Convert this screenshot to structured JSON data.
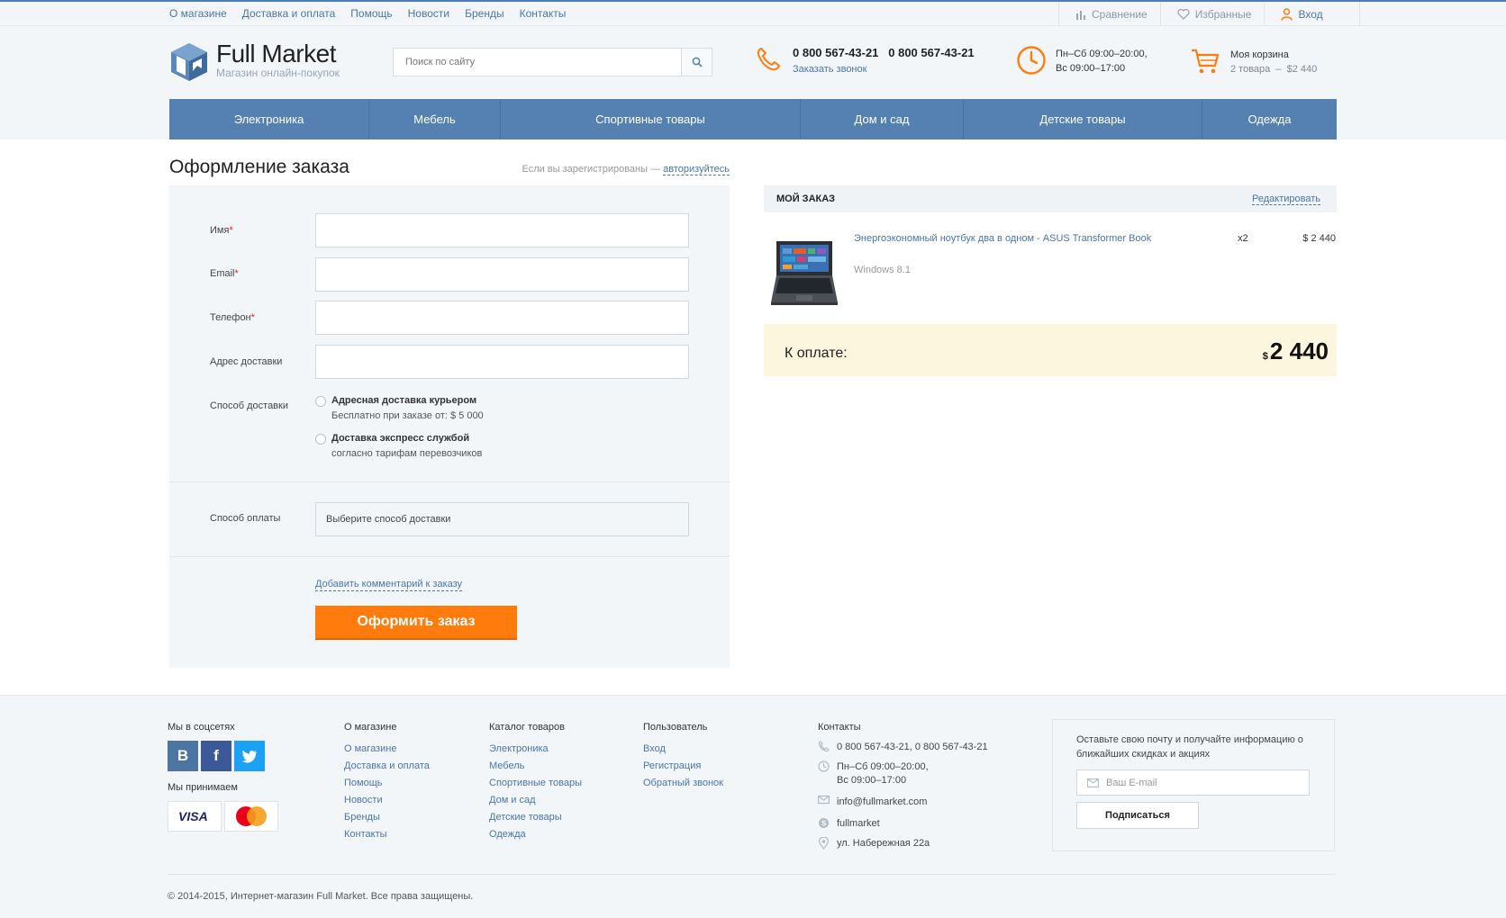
{
  "topnav": [
    "О магазине",
    "Доставка и оплата",
    "Помощь",
    "Новости",
    "Бренды",
    "Контакты"
  ],
  "topright": {
    "compare": "Сравнение",
    "favorites": "Избранные",
    "login": "Вход"
  },
  "logo": {
    "name": "Full Market",
    "tagline": "Магазин онлайн-покупок"
  },
  "search": {
    "placeholder": "Поиск по сайту"
  },
  "phone": {
    "numbers": "0 800 567-43-21   0 800 567-43-21",
    "callback": "Заказать звонок"
  },
  "hours": {
    "line1": "Пн–Сб 09:00–20:00,",
    "line2": "Вс 09:00–17:00"
  },
  "cart": {
    "title": "Моя корзина",
    "count": "2 товара  –  $2 440"
  },
  "mainnav": [
    "Электроника",
    "Мебель",
    "Спортивные товары",
    "Дом и сад",
    "Детские товары",
    "Одежда"
  ],
  "page": {
    "title": "Оформление заказа",
    "registered_text": "Если вы зарегистрированы — ",
    "login_link": "авторизуйтесь"
  },
  "form": {
    "name_label": "Имя",
    "email_label": "Email",
    "phone_label": "Телефон",
    "address_label": "Адрес доставки",
    "required_mark": "*",
    "delivery_label": "Способ доставки",
    "delivery_options": [
      {
        "title": "Адресная доставка курьером",
        "sub": "Бесплатно при заказе от: $ 5 000"
      },
      {
        "title": "Доставка экспресс службой",
        "sub": "согласно тарифам перевозчиков"
      }
    ],
    "payment_label": "Способ оплаты",
    "payment_value": "Выберите способ доставки",
    "comment_link": "Добавить комментарий к заказу",
    "submit": "Оформить заказ"
  },
  "order": {
    "title": "МОЙ ЗАКАЗ",
    "edit": "Редактировать",
    "product_name": "Энергоэкономный ноутбук два в одном - ASUS Transformer Book",
    "product_os": "Windows 8.1",
    "qty": "x2",
    "price": "$ 2 440",
    "total_label": "К оплате:",
    "total_currency": "$",
    "total_amount": "2 440"
  },
  "footer": {
    "social_title": "Мы в соцсетях",
    "accept_title": "Мы принимаем",
    "col_about": {
      "title": "О магазине",
      "links": [
        "О магазине",
        "Доставка и оплата",
        "Помощь",
        "Новости",
        "Бренды",
        "Контакты"
      ]
    },
    "col_catalog": {
      "title": "Каталог товаров",
      "links": [
        "Электроника",
        "Мебель",
        "Спортивные товары",
        "Дом и сад",
        "Детские товары",
        "Одежда"
      ]
    },
    "col_user": {
      "title": "Пользователь",
      "links": [
        "Вход",
        "Регистрация",
        "Обратный звонок"
      ]
    },
    "contacts": {
      "title": "Контакты",
      "phone": "0 800 567-43-21, 0 800 567-43-21",
      "hours1": "Пн–Сб 09:00–20:00,",
      "hours2": "Вс 09:00–17:00",
      "email": "info@fullmarket.com",
      "skype": "fullmarket",
      "address": "ул. Набережная 22а"
    },
    "subscribe": {
      "text": "Оставьте свою почту и получайте информацию о ближайших скидках и акциях",
      "placeholder": "Ваш E-mail",
      "button": "Подписаться"
    },
    "copyright": "© 2014-2015, Интернет-магазин Full Market. Все права защищены."
  },
  "colors": {
    "accent": "#ff7b0c",
    "nav": "#5580b2",
    "link": "#4a76a8"
  }
}
